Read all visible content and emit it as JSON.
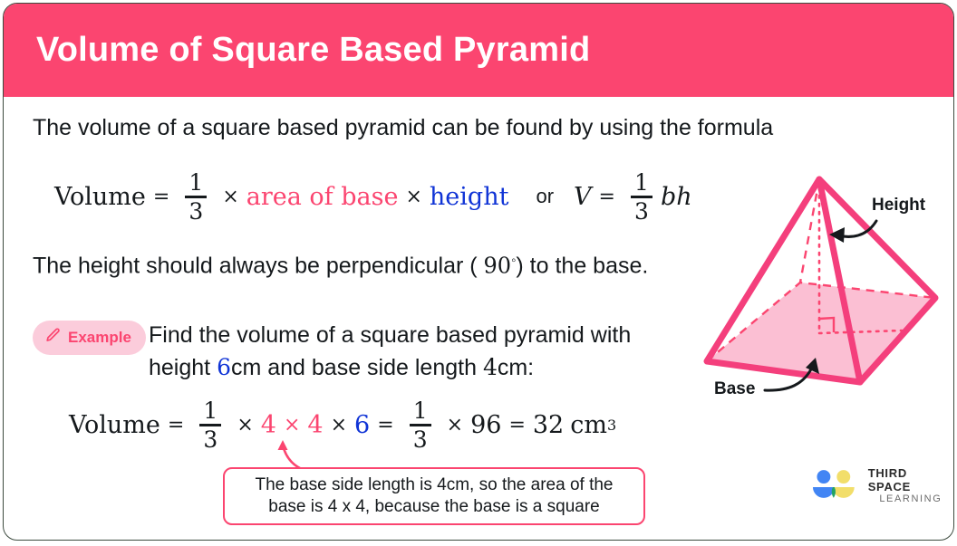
{
  "header": {
    "title": "Volume of Square Based Pyramid"
  },
  "intro": {
    "text": "The volume of a square based pyramid can be found by using the formula"
  },
  "formula": {
    "volume_word": "Volume",
    "equals": "=",
    "frac_num": "1",
    "frac_den": "3",
    "times": "×",
    "area_of_base": "area of base",
    "height_word": "height",
    "or": "or",
    "v_symbol": "V",
    "bh": "bh"
  },
  "perpendicular": {
    "before": "The height should always be perpendicular ( ",
    "angle": "90",
    "degree": "◦",
    "after": ") to the base."
  },
  "example": {
    "badge_label": "Example",
    "badge_icon": "pencil-icon",
    "line1": "Find the volume of a square based pyramid with",
    "line2_pre": "height ",
    "line2_height": "6",
    "line2_mid": "cm and base side length ",
    "line2_side": "4",
    "line2_post": "cm:"
  },
  "solution": {
    "volume_word": "Volume",
    "equals": "=",
    "frac_num": "1",
    "frac_den": "3",
    "times": "×",
    "side_a": "4",
    "side_b": "4",
    "height_val": "6",
    "equals2": "=",
    "product": "96",
    "equals3": "=",
    "answer": "32",
    "unit": "cm",
    "unit_power": "3"
  },
  "callout": {
    "line1": "The base side length is 4cm, so the area of the",
    "line2": "base is 4 x 4, because the base is a square"
  },
  "diagram": {
    "height_label": "Height",
    "base_label": "Base",
    "shape": "square-based-pyramid"
  },
  "logo": {
    "line1": "THIRD SPACE",
    "line2": "LEARNING"
  },
  "colors": {
    "header_pink": "#fb4570",
    "accent_pink": "#fb4570",
    "base_fill": "#fbbfd3",
    "badge_bg": "#fbccdb",
    "blue": "#1034d6",
    "text": "#15191c",
    "logo_blue": "#4285f4",
    "logo_yellow": "#f2de6a",
    "logo_green": "#21a366"
  }
}
